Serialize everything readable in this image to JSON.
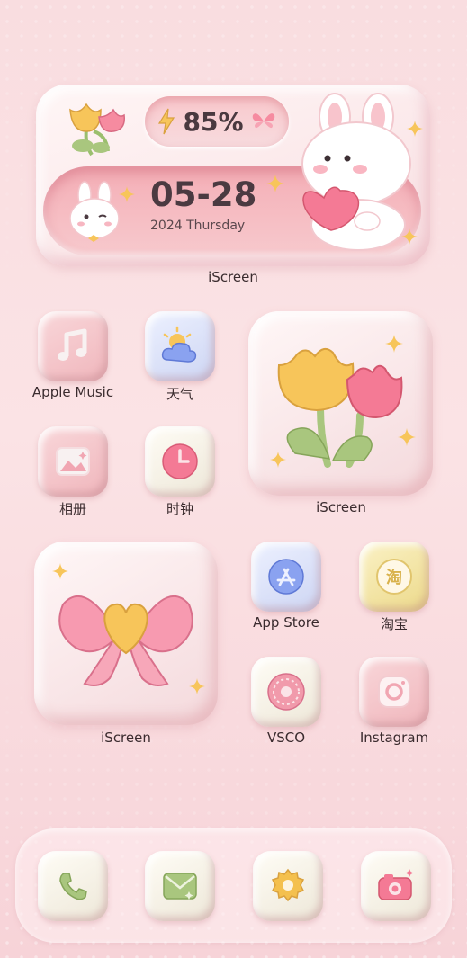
{
  "widget_top": {
    "battery": "85%",
    "date": "05-28",
    "year_day": "2024 Thursday",
    "label": "iScreen"
  },
  "apps": {
    "apple_music": "Apple Music",
    "weather": "天气",
    "photos": "相册",
    "clock": "时钟",
    "app_store": "App Store",
    "taobao": "淘宝",
    "vsco": "VSCO",
    "instagram": "Instagram"
  },
  "widgets": {
    "tulip_label": "iScreen",
    "bow_label": "iScreen"
  },
  "icons": {
    "taobao_glyph": "淘"
  },
  "dock": [
    "phone-icon",
    "messages-icon",
    "settings-icon",
    "camera-icon"
  ],
  "colors": {
    "accent_pink": "#f48aa0",
    "tulip_yellow": "#f7c55a",
    "leaf_green": "#a9c67e"
  }
}
